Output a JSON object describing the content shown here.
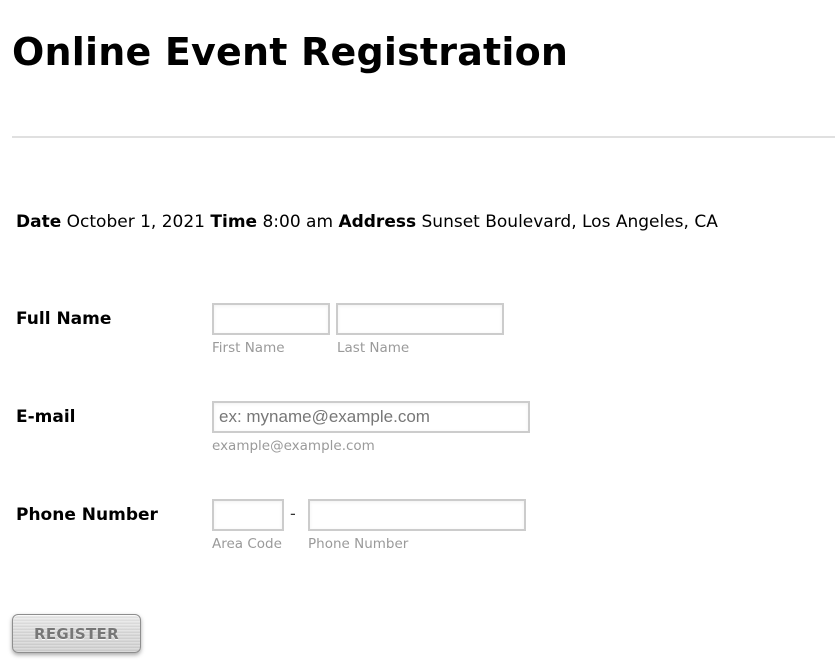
{
  "page": {
    "title": "Online Event Registration"
  },
  "event_info": {
    "date_label": "Date",
    "date_value": "October 1, 2021",
    "time_label": "Time",
    "time_value": "8:00 am",
    "address_label": "Address",
    "address_value": "Sunset Boulevard, Los Angeles, CA"
  },
  "form": {
    "full_name": {
      "label": "Full Name",
      "first_name": {
        "value": "",
        "placeholder": "",
        "sublabel": "First Name"
      },
      "last_name": {
        "value": "",
        "placeholder": "",
        "sublabel": "Last Name"
      }
    },
    "email": {
      "label": "E-mail",
      "value": "",
      "placeholder": "ex: myname@example.com",
      "sublabel": "example@example.com"
    },
    "phone": {
      "label": "Phone Number",
      "separator": "-",
      "area_code": {
        "value": "",
        "placeholder": "",
        "sublabel": "Area Code"
      },
      "number": {
        "value": "",
        "placeholder": "",
        "sublabel": "Phone Number"
      }
    },
    "submit_label": "REGISTER"
  }
}
